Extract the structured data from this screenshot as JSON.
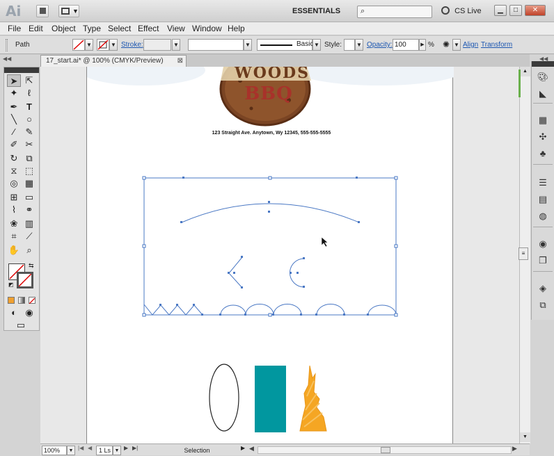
{
  "app": {
    "logo": "Ai",
    "workspace": "ESSENTIALS",
    "cs_live": "CS Live"
  },
  "menu": [
    "File",
    "Edit",
    "Object",
    "Type",
    "Select",
    "Effect",
    "View",
    "Window",
    "Help"
  ],
  "control": {
    "selection_type": "Path",
    "stroke_label": "Stroke:",
    "brush": "Basic",
    "style_label": "Style:",
    "opacity_label": "Opacity:",
    "opacity_value": "100",
    "percent": "%",
    "align_label": "Align",
    "transform_label": "Transform"
  },
  "document": {
    "tab_title": "17_start.ai* @ 100% (CMYK/Preview)",
    "close": "⊠"
  },
  "artwork": {
    "logo_top": "WOODS",
    "logo_sub": "BBQ",
    "address": "123 Straight Ave. Anytown, Wy 12345, 555-555-5555"
  },
  "status": {
    "zoom": "100%",
    "page": "1",
    "page_suffix": "Ls",
    "mode": "Selection"
  },
  "colors": {
    "teal": "#01979f",
    "orange": "#f5a623",
    "selection_blue": "#4a78c4",
    "logo_brown": "#8b4a25"
  }
}
